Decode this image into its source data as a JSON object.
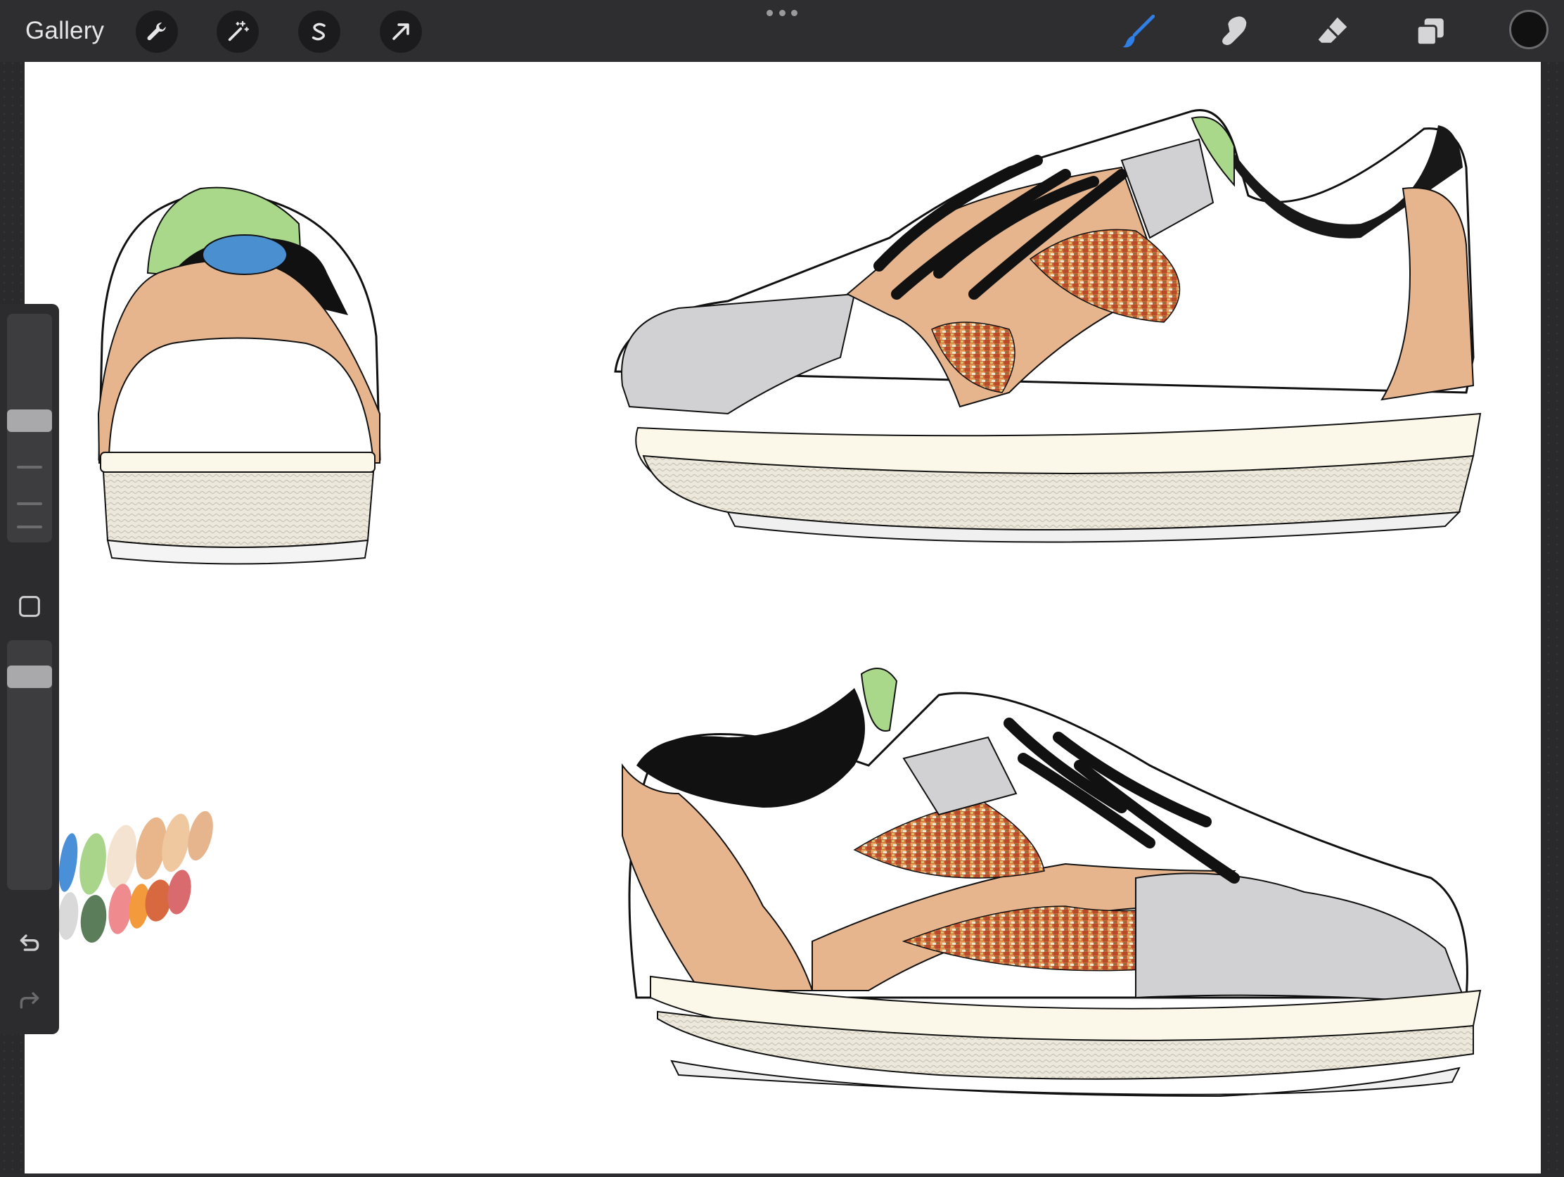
{
  "topbar": {
    "gallery_label": "Gallery",
    "actions": [
      {
        "name": "actions",
        "icon": "wrench-icon"
      },
      {
        "name": "adjustments",
        "icon": "magic-wand-icon"
      },
      {
        "name": "selection",
        "icon": "selection-s-icon"
      },
      {
        "name": "transform",
        "icon": "arrow-cursor-icon"
      }
    ],
    "tools": [
      {
        "name": "brush",
        "icon": "brush-icon",
        "active": true
      },
      {
        "name": "smudge",
        "icon": "smudge-finger-icon",
        "active": false
      },
      {
        "name": "eraser",
        "icon": "eraser-icon",
        "active": false
      },
      {
        "name": "layers",
        "icon": "layers-icon",
        "active": false
      }
    ],
    "active_color": "#111111",
    "accent_color": "#2f7fe6"
  },
  "sidebar": {
    "brush_size_level": 0.45,
    "opacity_level": 0.9,
    "icons": [
      "modify-square-icon",
      "undo-icon",
      "redo-icon"
    ]
  },
  "canvas": {
    "background": "#ffffff",
    "artwork": "sneaker-design-sketch",
    "swatches": [
      "#4a90d9",
      "#a8d58a",
      "#f4e3d0",
      "#e8b68a",
      "#f0c8a0",
      "#e6b58e",
      "#d9d9d9",
      "#5b7d5a",
      "#ef8a8f",
      "#f39a3c",
      "#d8683f",
      "#d96a6d"
    ]
  }
}
